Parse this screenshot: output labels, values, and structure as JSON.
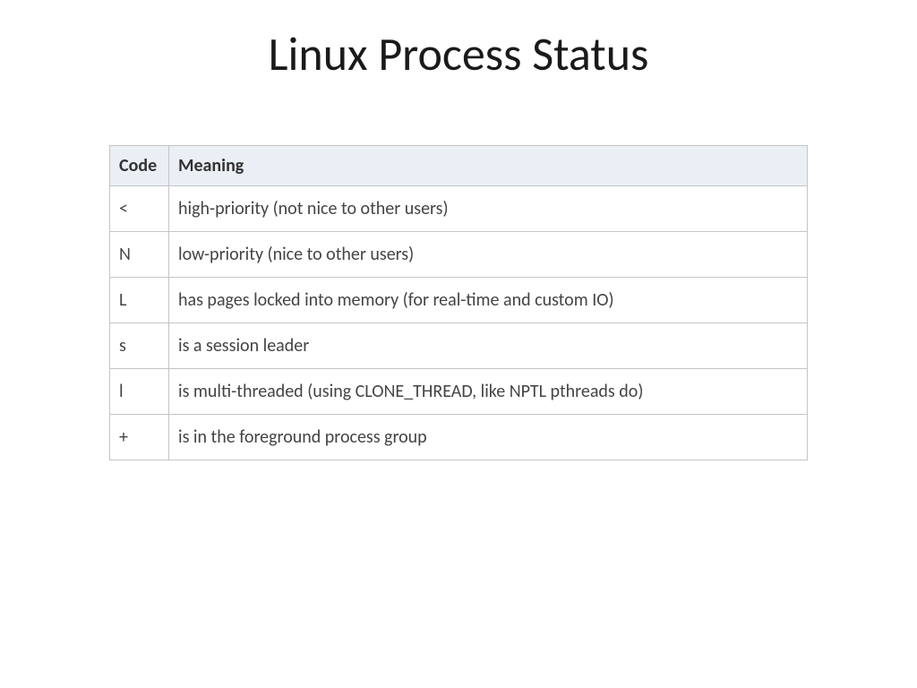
{
  "title": "Linux Process Status",
  "table": {
    "headers": {
      "code": "Code",
      "meaning": "Meaning"
    },
    "rows": [
      {
        "code": "<",
        "meaning": "high-priority (not nice to other users)"
      },
      {
        "code": "N",
        "meaning": "low-priority (nice to other users)"
      },
      {
        "code": "L",
        "meaning": "has pages locked into memory (for real-time and custom IO)"
      },
      {
        "code": "s",
        "meaning": "is a session leader"
      },
      {
        "code": "l",
        "meaning": "is multi-threaded (using CLONE_THREAD, like NPTL pthreads do)"
      },
      {
        "code": "+",
        "meaning": "is in the foreground process group"
      }
    ]
  }
}
